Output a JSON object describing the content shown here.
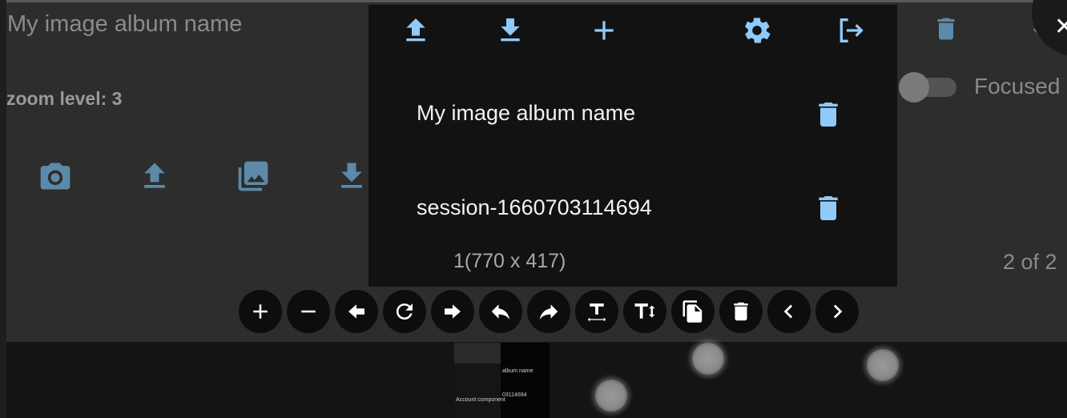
{
  "album_title_input": {
    "value": "My image album name"
  },
  "zoom": {
    "label": "zoom level: 3"
  },
  "focused_toggle": {
    "label": "Focused",
    "checked": false
  },
  "page_indicator": "2 of 2",
  "dropdown": {
    "toolbar_icons": [
      "upload-icon",
      "download-icon",
      "add-icon",
      "settings-icon",
      "logout-icon"
    ],
    "albums": [
      {
        "name": "My image album name"
      },
      {
        "name": "session-1660703114694"
      }
    ],
    "item_info": "1(770 x 417)"
  },
  "background_icons": [
    "camera-icon",
    "upload-icon",
    "photo-library-icon",
    "download-icon",
    "delete-icon",
    "back-arrow-icon",
    "close-icon"
  ],
  "toolbar": [
    "zoom-in-icon",
    "zoom-out-icon",
    "move-left-icon",
    "rotate-icon",
    "move-right-icon",
    "undo-icon",
    "redo-icon",
    "text-width-icon",
    "text-height-icon",
    "copy-icon",
    "delete-icon",
    "previous-icon",
    "next-icon"
  ],
  "thumbnail": {
    "lines": [
      "album name",
      "Account component",
      "03114694"
    ]
  },
  "colors": {
    "accent": "#90caf9",
    "accent_dim": "#5c8aa8",
    "panel": "#2d2d2d",
    "dropdown_bg": "#121212"
  }
}
